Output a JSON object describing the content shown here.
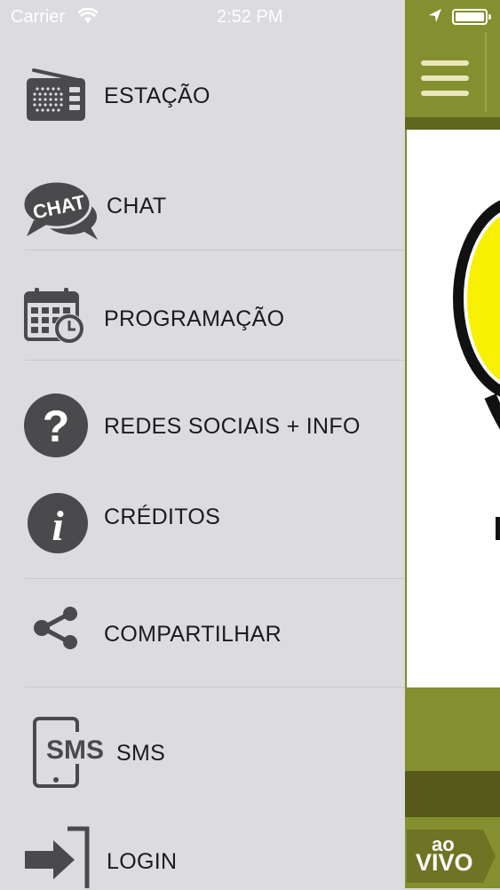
{
  "status_bar": {
    "carrier": "Carrier",
    "time": "2:52 PM"
  },
  "menu": {
    "items": [
      {
        "label": "ESTAÇÃO",
        "icon": "radio-icon"
      },
      {
        "label": "CHAT",
        "icon": "chat-bubble-icon"
      },
      {
        "label": "PROGRAMAÇÃO",
        "icon": "calendar-clock-icon"
      },
      {
        "label": "REDES SOCIAIS + INFO",
        "icon": "question-icon"
      },
      {
        "label": "CRÉDITOS",
        "icon": "info-icon"
      },
      {
        "label": "COMPARTILHAR",
        "icon": "share-icon"
      },
      {
        "label": "SMS",
        "icon": "sms-phone-icon"
      },
      {
        "label": "LOGIN",
        "icon": "login-arrow-icon"
      }
    ],
    "chat_icon_text": "CHAT",
    "sms_icon_text": "SMS"
  },
  "content": {
    "live_badge_line1": "ao",
    "live_badge_line2": "VIVO"
  },
  "colors": {
    "drawer_bg": "#dcdbdf",
    "accent_olive": "#848f2f",
    "icon_gray": "#4a4a4c"
  }
}
